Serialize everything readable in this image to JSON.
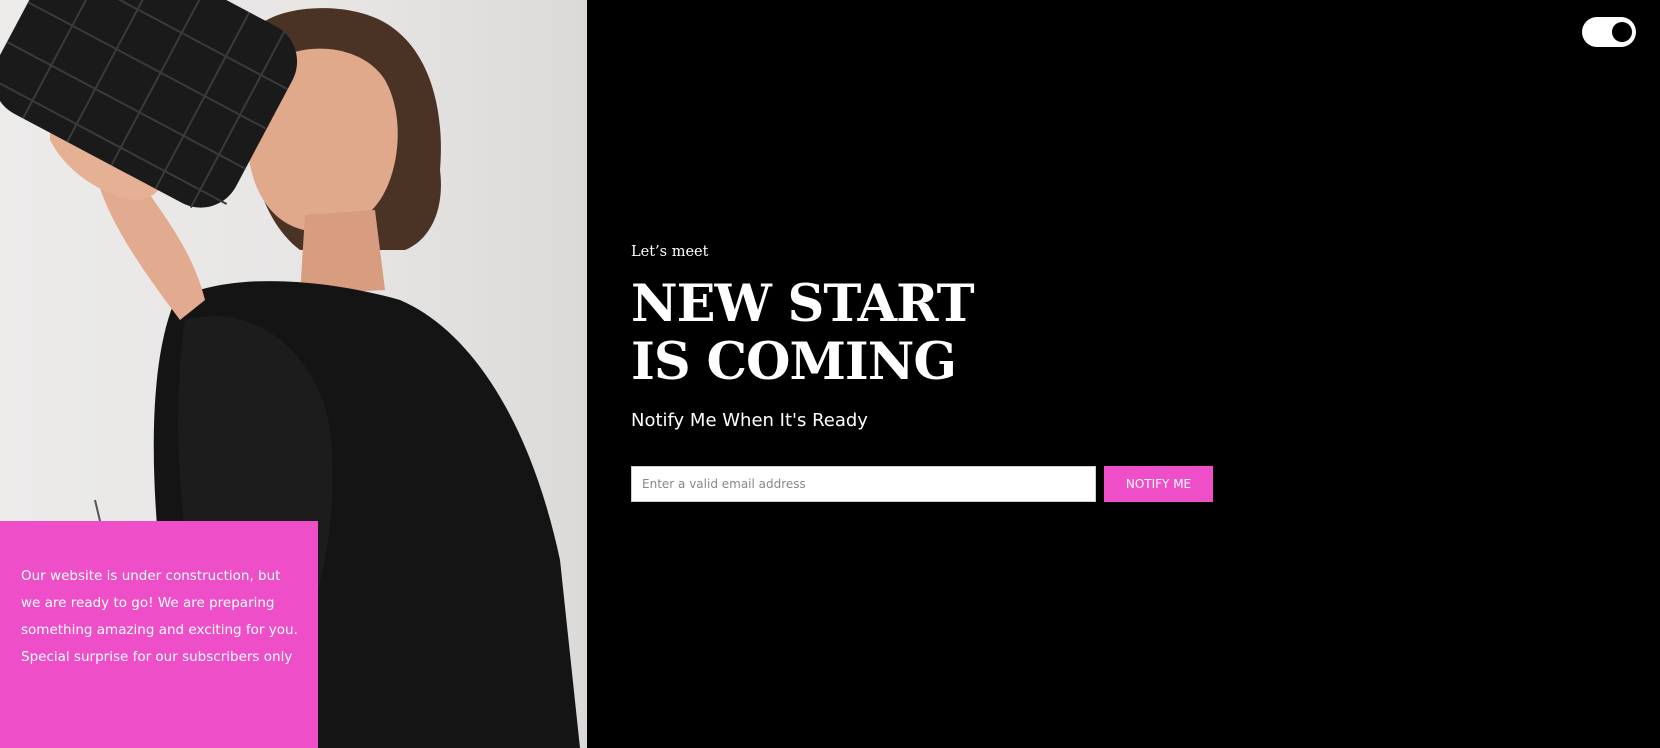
{
  "hero": {
    "image_icon": "model-photo"
  },
  "info_panel": {
    "text": "Our website is under construction, but we are ready to go! We are preparing something amazing and exciting for you. Special surprise for our subscribers only",
    "bg_color": "#ee4ec8"
  },
  "toggle": {
    "state": "on"
  },
  "intro": {
    "eyebrow": "Let’s meet",
    "headline_line1": "NEW START",
    "headline_line2": "IS COMING",
    "subhead": "Notify Me When It's Ready"
  },
  "form": {
    "email_placeholder": "Enter a valid email address",
    "email_value": "",
    "button_label": "NOTIFY ME"
  },
  "colors": {
    "accent": "#ee4ec8",
    "background": "#000000"
  }
}
